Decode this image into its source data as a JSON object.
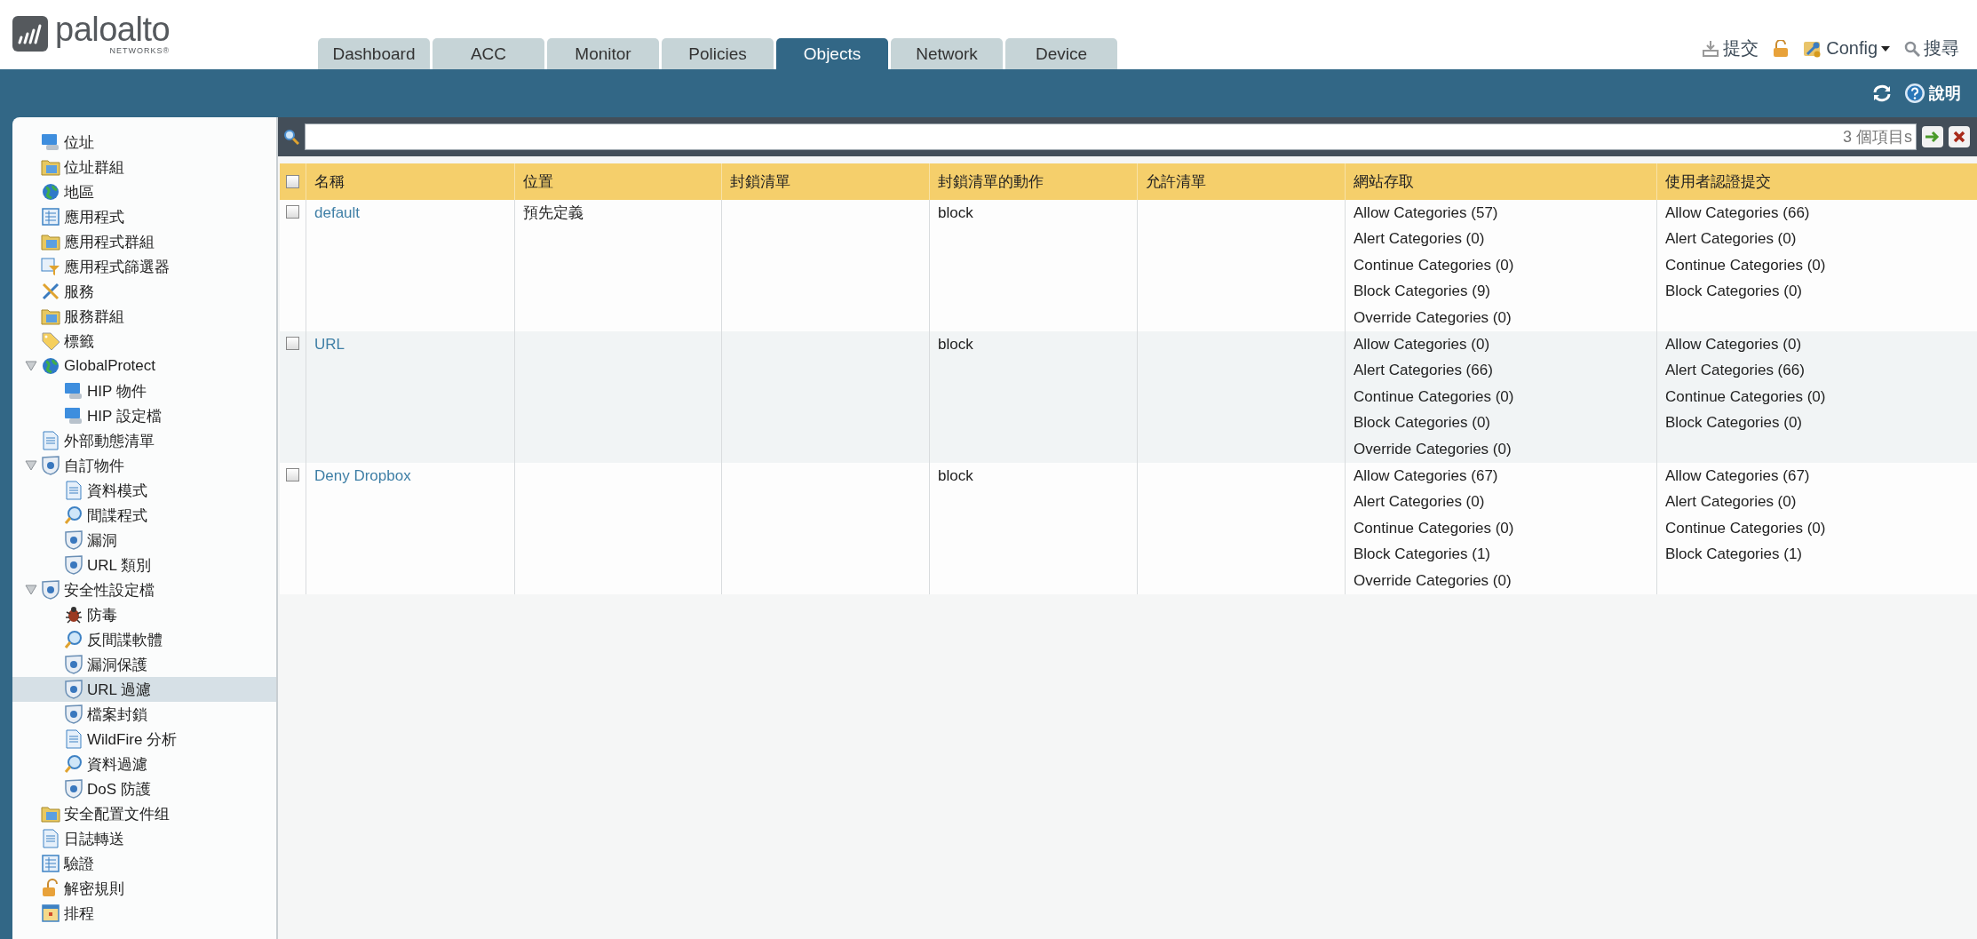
{
  "header": {
    "logo": {
      "name": "paloalto",
      "subtitle": "NETWORKS®"
    },
    "tabs": [
      {
        "label": "Dashboard",
        "selected": false
      },
      {
        "label": "ACC",
        "selected": false
      },
      {
        "label": "Monitor",
        "selected": false
      },
      {
        "label": "Policies",
        "selected": false
      },
      {
        "label": "Objects",
        "selected": true
      },
      {
        "label": "Network",
        "selected": false
      },
      {
        "label": "Device",
        "selected": false
      }
    ],
    "commit": "提交",
    "config": "Config",
    "search": "搜尋"
  },
  "ribbon": {
    "help": "說明"
  },
  "sidebar": {
    "items": [
      {
        "label": "位址",
        "selected": false
      },
      {
        "label": "位址群組",
        "selected": false
      },
      {
        "label": "地區",
        "selected": false
      },
      {
        "label": "應用程式",
        "selected": false
      },
      {
        "label": "應用程式群組",
        "selected": false
      },
      {
        "label": "應用程式篩選器",
        "selected": false
      },
      {
        "label": "服務",
        "selected": false
      },
      {
        "label": "服務群組",
        "selected": false
      },
      {
        "label": "標籤",
        "selected": false
      },
      {
        "label": "GlobalProtect",
        "selected": false,
        "expanded": true,
        "children": [
          {
            "label": "HIP 物件",
            "selected": false
          },
          {
            "label": "HIP 設定檔",
            "selected": false
          }
        ]
      },
      {
        "label": "外部動態清單",
        "selected": false
      },
      {
        "label": "自訂物件",
        "selected": false,
        "expanded": true,
        "children": [
          {
            "label": "資料模式",
            "selected": false
          },
          {
            "label": "間諜程式",
            "selected": false
          },
          {
            "label": "漏洞",
            "selected": false
          },
          {
            "label": "URL 類別",
            "selected": false
          }
        ]
      },
      {
        "label": "安全性設定檔",
        "selected": false,
        "expanded": true,
        "children": [
          {
            "label": "防毒",
            "selected": false
          },
          {
            "label": "反間諜軟體",
            "selected": false
          },
          {
            "label": "漏洞保護",
            "selected": false
          },
          {
            "label": "URL 過濾",
            "selected": true
          },
          {
            "label": "檔案封鎖",
            "selected": false
          },
          {
            "label": "WildFire 分析",
            "selected": false
          },
          {
            "label": "資料過濾",
            "selected": false
          },
          {
            "label": "DoS 防護",
            "selected": false
          }
        ]
      },
      {
        "label": "安全配置文件组",
        "selected": false
      },
      {
        "label": "日誌轉送",
        "selected": false
      },
      {
        "label": "驗證",
        "selected": false
      },
      {
        "label": "解密規則",
        "selected": false
      },
      {
        "label": "排程",
        "selected": false
      }
    ]
  },
  "filter": {
    "item_count": "3 個項目s"
  },
  "table": {
    "select_all_checked": false,
    "columns": [
      {
        "label": "名稱"
      },
      {
        "label": "位置"
      },
      {
        "label": "封鎖清單"
      },
      {
        "label": "封鎖清單的動作"
      },
      {
        "label": "允許清單"
      },
      {
        "label": "網站存取"
      },
      {
        "label": "使用者認證提交"
      }
    ],
    "rows": [
      {
        "checked": false,
        "name": "default",
        "location": "預先定義",
        "action": "block",
        "site_access": [
          "Allow Categories (57)",
          "Alert Categories (0)",
          "Continue Categories (0)",
          "Block Categories (9)",
          "Override Categories (0)"
        ],
        "user_credential_submission": [
          "Allow Categories (66)",
          "Alert Categories (0)",
          "Continue Categories (0)",
          "Block Categories (0)"
        ]
      },
      {
        "checked": false,
        "name": "URL",
        "action": "block",
        "site_access": [
          "Allow Categories (0)",
          "Alert Categories (66)",
          "Continue Categories (0)",
          "Block Categories (0)",
          "Override Categories (0)"
        ],
        "user_credential_submission": [
          "Allow Categories (0)",
          "Alert Categories (66)",
          "Continue Categories (0)",
          "Block Categories (0)"
        ]
      },
      {
        "checked": false,
        "name": "Deny Dropbox",
        "action": "block",
        "site_access": [
          "Allow Categories (67)",
          "Alert Categories (0)",
          "Continue Categories (0)",
          "Block Categories (1)",
          "Override Categories (0)"
        ],
        "user_credential_submission": [
          "Allow Categories (67)",
          "Alert Categories (0)",
          "Continue Categories (0)",
          "Block Categories (1)"
        ]
      }
    ]
  }
}
